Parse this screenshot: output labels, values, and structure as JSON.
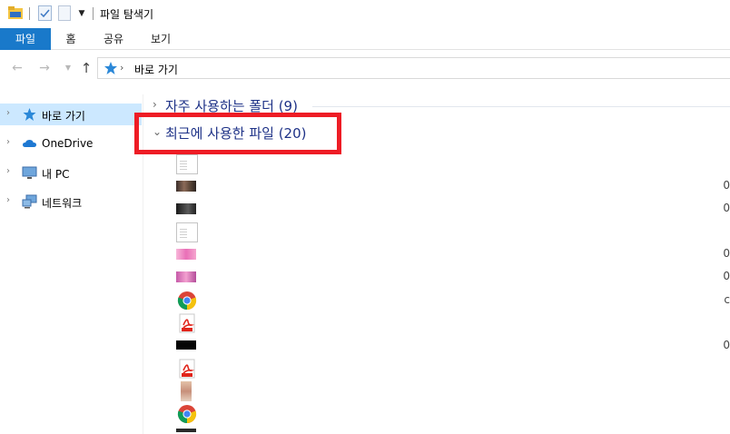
{
  "window": {
    "title": "파일 탐색기"
  },
  "ribbon": {
    "tabs": [
      "파일",
      "홈",
      "공유",
      "보기"
    ]
  },
  "address": {
    "path": "바로 가기"
  },
  "sidebar": {
    "items": [
      {
        "label": "바로 가기",
        "icon": "star-icon",
        "selected": true
      },
      {
        "label": "OneDrive",
        "icon": "cloud-icon",
        "selected": false
      },
      {
        "label": "내 PC",
        "icon": "pc-icon",
        "selected": false
      },
      {
        "label": "네트워크",
        "icon": "network-icon",
        "selected": false
      }
    ]
  },
  "content": {
    "groups": [
      {
        "title": "자주 사용하는 폴더 (9)",
        "expanded": false
      },
      {
        "title": "최근에 사용한 파일 (20)",
        "expanded": true
      }
    ],
    "recent_files": [
      {
        "icon": "document-icon",
        "date": ""
      },
      {
        "icon": "image-thumbnail-icon",
        "date": "0"
      },
      {
        "icon": "image-thumbnail-icon",
        "date": "0"
      },
      {
        "icon": "document-icon",
        "date": ""
      },
      {
        "icon": "image-thumbnail-icon",
        "date": "0"
      },
      {
        "icon": "image-thumbnail-icon",
        "date": "0"
      },
      {
        "icon": "chrome-icon",
        "date": "c"
      },
      {
        "icon": "pdf-icon",
        "date": ""
      },
      {
        "icon": "image-thumbnail-icon",
        "date": "0"
      },
      {
        "icon": "pdf-icon",
        "date": ""
      },
      {
        "icon": "image-thumbnail-icon",
        "date": ""
      },
      {
        "icon": "chrome-icon",
        "date": ""
      },
      {
        "icon": "image-thumbnail-icon",
        "date": ""
      }
    ]
  },
  "colors": {
    "ribbon_file_tab": "#1979ca",
    "selection": "#cce8ff",
    "highlight_box": "#ee1c25",
    "group_title": "#1e3287"
  }
}
